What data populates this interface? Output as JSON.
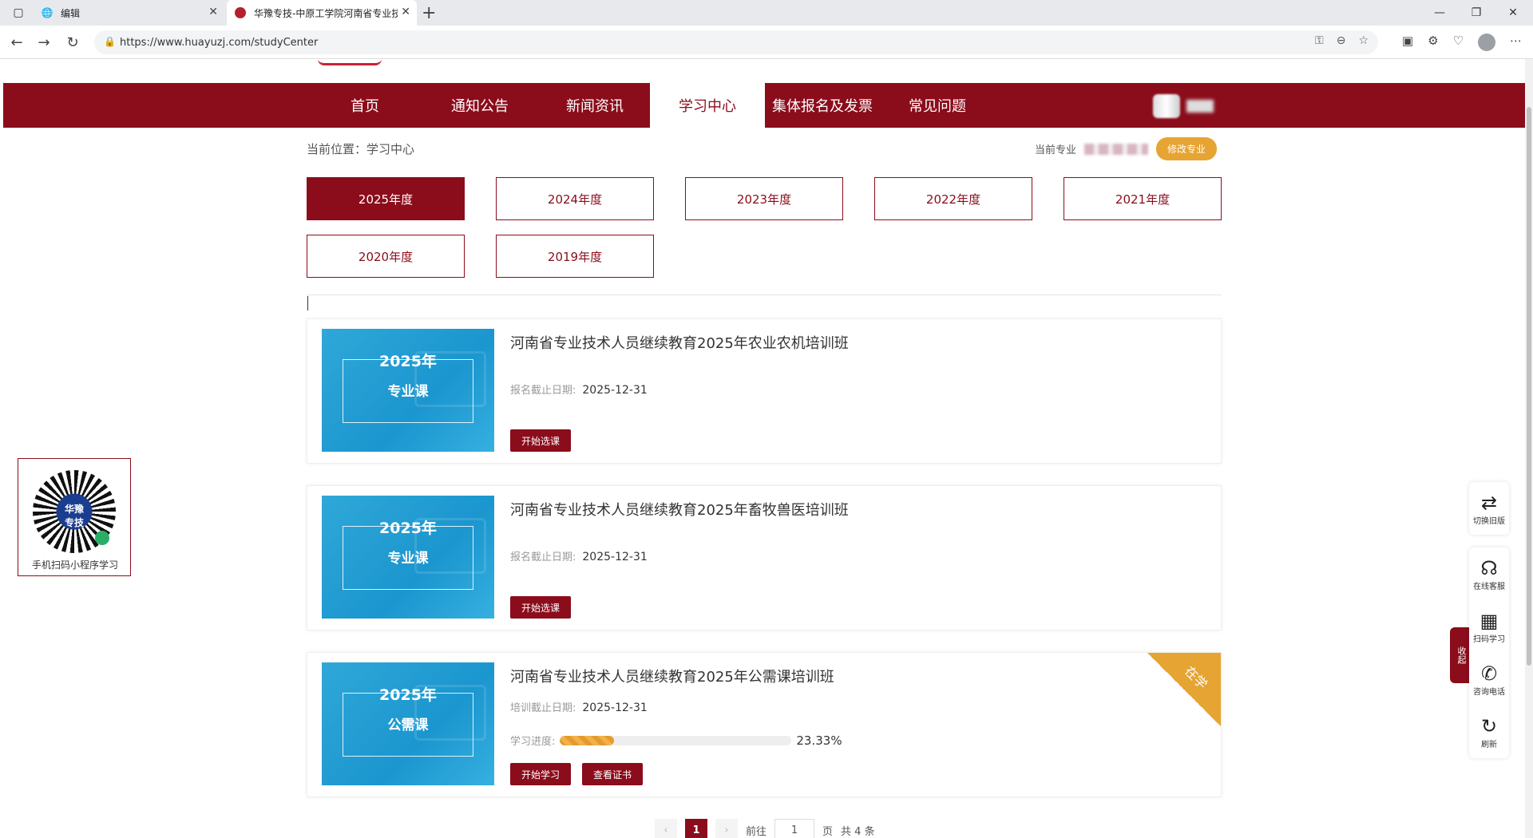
{
  "browser": {
    "tabs": [
      {
        "title": "编辑"
      },
      {
        "title": "华豫专技-中原工学院河南省专业技术人员继续教育"
      }
    ],
    "url": "https://www.huayuzj.com/studyCenter"
  },
  "nav": {
    "items": [
      "首页",
      "通知公告",
      "新闻资讯",
      "学习中心",
      "集体报名及发票",
      "常见问题"
    ],
    "active": "学习中心"
  },
  "breadcrumb": "当前位置：学习中心",
  "major": {
    "label": "当前专业",
    "button": "修改专业"
  },
  "years": [
    "2025年度",
    "2024年度",
    "2023年度",
    "2022年度",
    "2021年度",
    "2020年度",
    "2019年度"
  ],
  "active_year": "2025年度",
  "courses": [
    {
      "thumb_year": "2025年",
      "thumb_kind": "专业课",
      "title": "河南省专业技术人员继续教育2025年农业农机培训班",
      "deadline_label": "报名截止日期:",
      "deadline": "2025-12-31",
      "buttons": [
        "开始选课"
      ]
    },
    {
      "thumb_year": "2025年",
      "thumb_kind": "专业课",
      "title": "河南省专业技术人员继续教育2025年畜牧兽医培训班",
      "deadline_label": "报名截止日期:",
      "deadline": "2025-12-31",
      "buttons": [
        "开始选课"
      ]
    },
    {
      "thumb_year": "2025年",
      "thumb_kind": "公需课",
      "title": "河南省专业技术人员继续教育2025年公需课培训班",
      "deadline_label": "培训截止日期:",
      "deadline": "2025-12-31",
      "progress_label": "学习进度:",
      "progress": 23.33,
      "progress_text": "23.33%",
      "ribbon": "在学",
      "buttons": [
        "开始学习",
        "查看证书"
      ]
    }
  ],
  "pager": {
    "prev": "‹",
    "current": "1",
    "next": "›",
    "goto_label": "前往",
    "goto_value": "1",
    "page_suffix": "页",
    "total": "共 4 条"
  },
  "qr_caption": "手机扫码小程序学习",
  "side_tools": [
    {
      "icon": "swap-icon",
      "glyph": "⇄",
      "label": "切换旧版"
    },
    {
      "icon": "headset-icon",
      "glyph": "☊",
      "label": "在线客服"
    },
    {
      "icon": "qr-icon",
      "glyph": "▦",
      "label": "扫码学习"
    },
    {
      "icon": "phone-icon",
      "glyph": "✆",
      "label": "咨询电话"
    },
    {
      "icon": "refresh-icon",
      "glyph": "↻",
      "label": "刷新"
    }
  ],
  "fold_label": "收起",
  "colors": {
    "brand": "#8b0c1b",
    "accent": "#e6a433"
  }
}
